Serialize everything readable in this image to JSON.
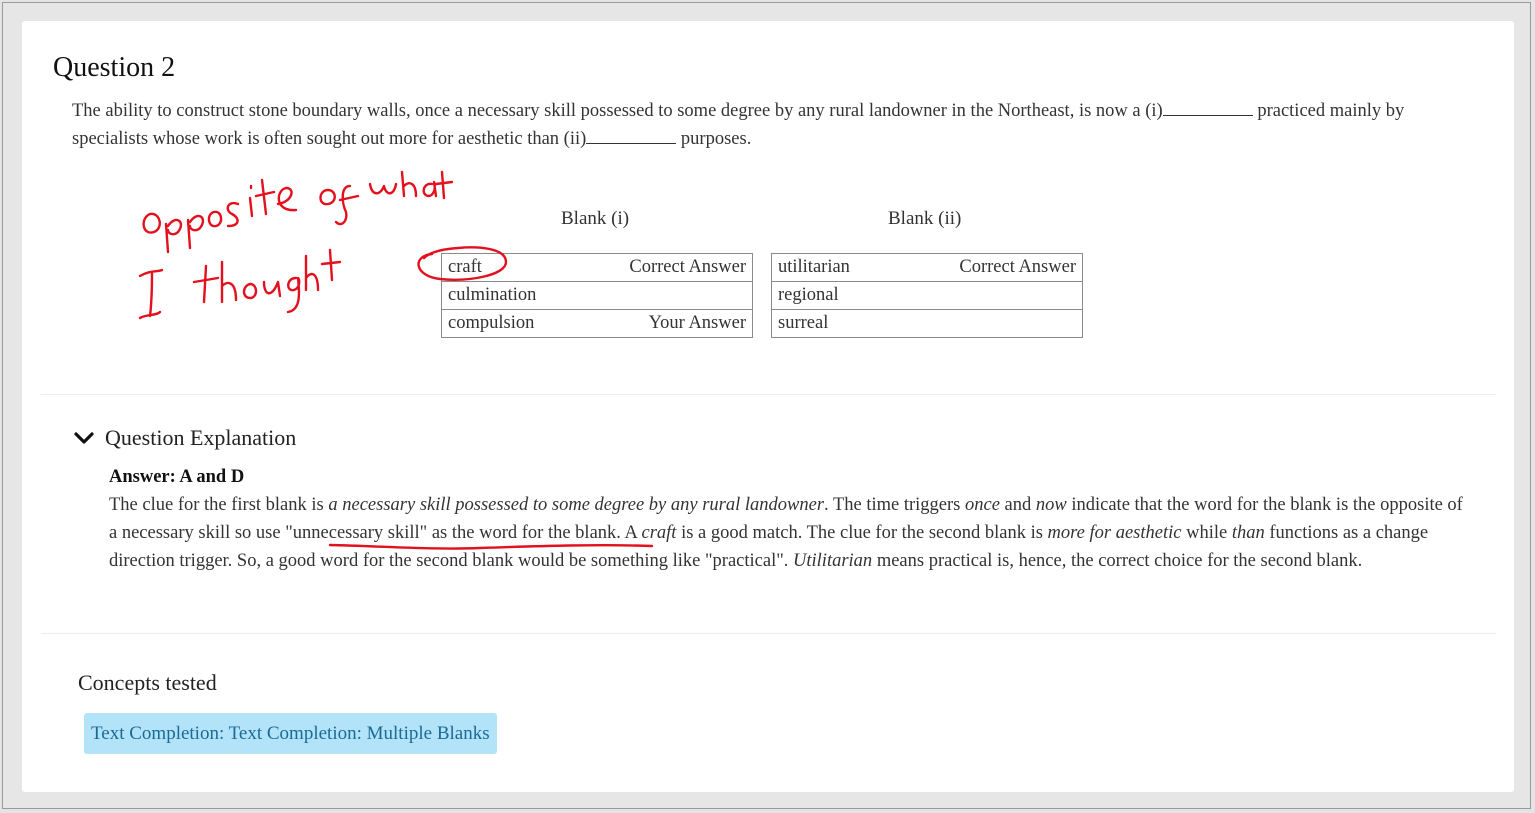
{
  "question": {
    "title": "Question 2",
    "text_1": "The ability to construct stone boundary walls, once a necessary skill possessed to some degree by any rural landowner in the Northeast, is now a (i)",
    "text_2": " practiced mainly by specialists whose work is often sought out more for aesthetic than (ii)",
    "text_3": " purposes."
  },
  "blanks": [
    {
      "heading": "Blank (i)",
      "options": [
        {
          "text": "craft",
          "mark": "Correct Answer"
        },
        {
          "text": "culmination",
          "mark": ""
        },
        {
          "text": "compulsion",
          "mark": "Your Answer"
        }
      ]
    },
    {
      "heading": "Blank (ii)",
      "options": [
        {
          "text": "utilitarian",
          "mark": "Correct Answer"
        },
        {
          "text": "regional",
          "mark": ""
        },
        {
          "text": "surreal",
          "mark": ""
        }
      ]
    }
  ],
  "annotation": {
    "line1": "opposite of what",
    "line2": "I thought",
    "color": "#e3101e"
  },
  "explanation": {
    "heading": "Question Explanation",
    "answer": "Answer: A and D",
    "p1": "The clue for the first blank is ",
    "p1_em": "a necessary skill possessed to some degree by any rural landowner",
    "p2": ". The time triggers ",
    "p2_em": "once",
    "p3": " and ",
    "p3_em": "now",
    "p4": " indicate that the word for the blank is the opposite of a necessary skill so use \"unnecessary skill\" as the word for the blank. A ",
    "p4_em": "craft",
    "p5": " is a good match. The clue for the second blank is ",
    "p5_em": "more for aesthetic",
    "p6": " while ",
    "p6_em": "than",
    "p7": " functions as a change direction trigger. So, a good word for the second blank would be something like \"practical\". ",
    "p7_em": "Utilitarian",
    "p8": " means practical is, hence, the correct choice for the second blank."
  },
  "concepts": {
    "title": "Concepts tested",
    "tag": "Text Completion: Text Completion: Multiple Blanks"
  },
  "colors": {
    "correct": "#9acd1a",
    "your_answer": "#d0212c",
    "tag_bg": "#b3e3f8",
    "tag_text": "#1a6a96"
  }
}
